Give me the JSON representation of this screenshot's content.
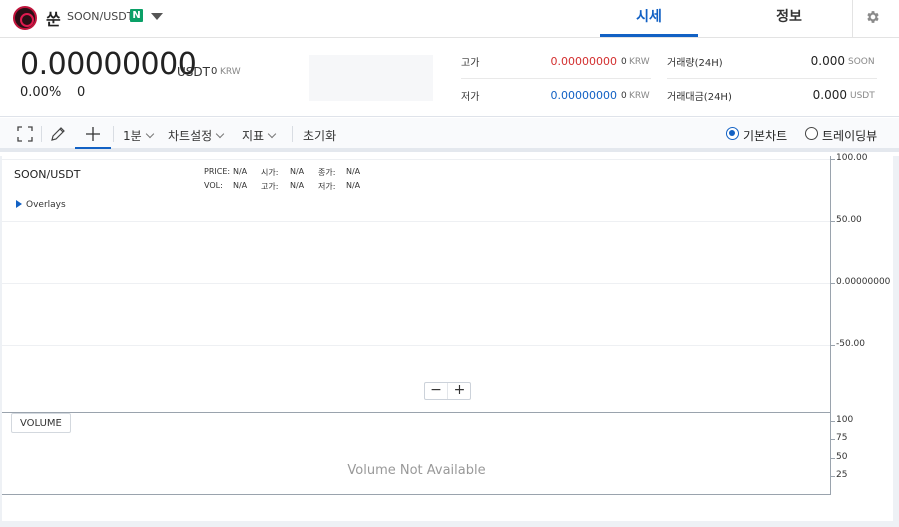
{
  "header": {
    "coin_name": "쑨",
    "pair": "SOON/USDT",
    "badge": "N",
    "tabs": [
      {
        "label": "시세",
        "active": true
      },
      {
        "label": "정보",
        "active": false
      }
    ],
    "icons": {
      "logo": "coin-logo",
      "dropdown": "caret-down-icon",
      "settings": "gear-icon"
    }
  },
  "summary": {
    "price": "0.00000000",
    "price_unit": "USDT",
    "krw_value": "0",
    "krw_unit": "KRW",
    "change_pct": "0.00%",
    "change_abs": "0",
    "stats": {
      "high_label": "고가",
      "high_value": "0.00000000",
      "high_unit_val": "0",
      "high_unit": "KRW",
      "low_label": "저가",
      "low_value": "0.00000000",
      "low_unit_val": "0",
      "low_unit": "KRW",
      "volume_label": "거래량(24H)",
      "volume_value": "0.000",
      "volume_unit": "SOON",
      "amount_label": "거래대금(24H)",
      "amount_value": "0.000",
      "amount_unit": "USDT"
    },
    "colors": {
      "high": "#d32f2f",
      "low": "#1261c4"
    }
  },
  "toolbar": {
    "icons": [
      "fullscreen-icon",
      "draw-pen-icon",
      "crosshair-icon"
    ],
    "interval": "1분",
    "chart_settings": "차트설정",
    "indicators": "지표",
    "reset": "초기화",
    "view_basic": "기본차트",
    "view_tradingview": "트레이딩뷰",
    "selected_view": "기본차트"
  },
  "chart": {
    "symbol": "SOON/USDT",
    "legend": {
      "price_label": "PRICE:",
      "price_value": "N/A",
      "open_label": "시가:",
      "open_value": "N/A",
      "close_label": "종가:",
      "close_value": "N/A",
      "vol_label": "VOL:",
      "vol_value": "N/A",
      "high_label": "고가:",
      "high_value": "N/A",
      "low_label": "저가:",
      "low_value": "N/A"
    },
    "overlays_label": "Overlays",
    "y_axis_labels": [
      "100.00",
      "50.00",
      "0.00000000",
      "-50.00"
    ],
    "zoom_out": "−",
    "zoom_in": "+",
    "volume_button": "VOLUME",
    "volume_axis_labels": [
      "100",
      "75",
      "50",
      "25"
    ],
    "volume_message": "Volume Not Available",
    "accent": "#1261c4"
  }
}
